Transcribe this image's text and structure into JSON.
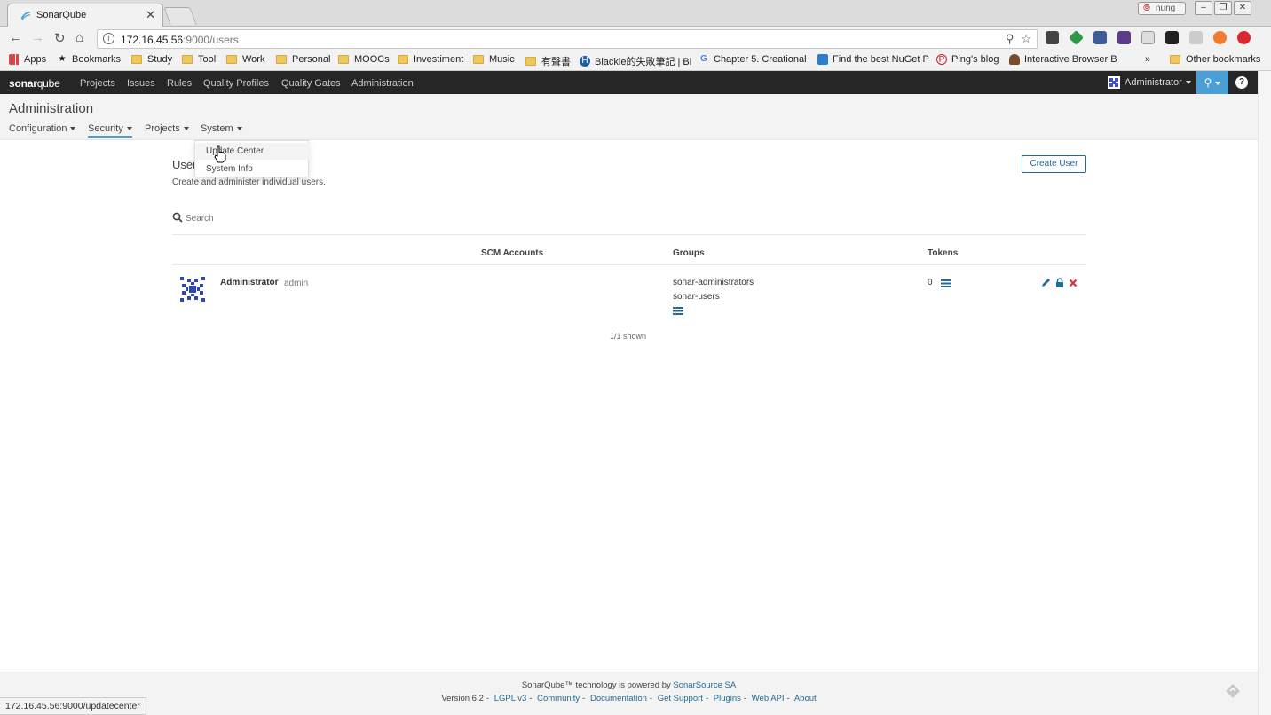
{
  "browser": {
    "tab_title": "SonarQube",
    "user_badge": "nung",
    "url_host": "172.16.45.56",
    "url_path": ":9000/users",
    "status_url": "172.16.45.56:9000/updatecenter",
    "bookmarks": [
      {
        "label": "Apps",
        "icon": "apps-grid-icon"
      },
      {
        "label": "Bookmarks",
        "icon": "star-icon"
      },
      {
        "label": "Study",
        "icon": "folder-icon"
      },
      {
        "label": "Tool",
        "icon": "folder-icon"
      },
      {
        "label": "Work",
        "icon": "folder-icon"
      },
      {
        "label": "Personal",
        "icon": "folder-icon"
      },
      {
        "label": "MOOCs",
        "icon": "folder-icon"
      },
      {
        "label": "Investiment",
        "icon": "folder-icon"
      },
      {
        "label": "Music",
        "icon": "folder-icon"
      },
      {
        "label": "有聲書",
        "icon": "folder-icon"
      },
      {
        "label": "Blackie的失敗筆記 | Bl",
        "icon": "site-h-icon"
      },
      {
        "label": "Chapter 5. Creational",
        "icon": "google-g-icon"
      },
      {
        "label": "Find the best NuGet P",
        "icon": "nuget-icon"
      },
      {
        "label": "Ping's blog",
        "icon": "pinterest-icon"
      },
      {
        "label": "Interactive Browser B",
        "icon": "site-icon"
      }
    ],
    "overflow": "»",
    "other_bookmarks": "Other bookmarks"
  },
  "nav": {
    "logo_bold": "sonar",
    "logo_light": "qube",
    "links": [
      "Projects",
      "Issues",
      "Rules",
      "Quality Profiles",
      "Quality Gates",
      "Administration"
    ],
    "user": "Administrator",
    "help": "?"
  },
  "admin": {
    "title": "Administration",
    "menus": [
      "Configuration",
      "Security",
      "Projects",
      "System"
    ],
    "active_menu": "Security",
    "system_dropdown": [
      "Update Center",
      "System Info"
    ]
  },
  "page": {
    "title": "Users",
    "description": "Create and administer individual users.",
    "create_button": "Create User",
    "search_placeholder": "Search",
    "columns": {
      "scm": "SCM Accounts",
      "groups": "Groups",
      "tokens": "Tokens"
    },
    "users": [
      {
        "name": "Administrator",
        "login": "admin",
        "groups": [
          "sonar-administrators",
          "sonar-users"
        ],
        "tokens": "0"
      }
    ],
    "shown": "1/1 shown"
  },
  "footer": {
    "line1_prefix": "SonarQube™ technology is powered by ",
    "line1_link": "SonarSource SA",
    "version": "Version 6.2",
    "links": [
      "LGPL v3",
      "Community",
      "Documentation",
      "Get Support",
      "Plugins",
      "Web API",
      "About"
    ]
  },
  "colors": {
    "nav_bg": "#262626",
    "accent": "#4b9fd5",
    "link": "#236a97",
    "delete": "#d4333f"
  }
}
